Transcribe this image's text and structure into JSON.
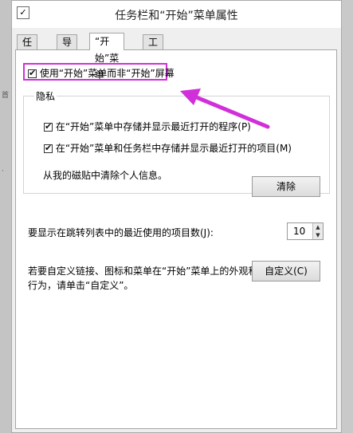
{
  "window": {
    "title": "任务栏和“开始”菜单属性",
    "title_icon": "checkbox-icon"
  },
  "tabs": [
    {
      "label": "任务栏",
      "active": false
    },
    {
      "label": "导航",
      "active": false
    },
    {
      "label": "“开始”菜单",
      "active": true
    },
    {
      "label": "工具栏",
      "active": false
    }
  ],
  "start_menu": {
    "use_start_screen": {
      "label": "使用“开始”菜单而非“开始”屏幕",
      "checked": true
    },
    "privacy": {
      "label": "隐私",
      "store_programs": {
        "label": "在“开始”菜单中存储并显示最近打开的程序(P)",
        "checked": true
      },
      "store_items": {
        "label": "在“开始”菜单和任务栏中存储并显示最近打开的项目(M)",
        "checked": true
      },
      "clear_text": "从我的磁贴中清除个人信息。",
      "clear_button": "清除"
    },
    "jump_list": {
      "label": "要显示在跳转列表中的最近使用的项目数(J):",
      "value": "10"
    },
    "customize": {
      "text_line1": "若要自定义链接、图标和菜单在“开始”菜单上的外观和",
      "text_line2": "行为，请单击“自定义”。",
      "button": "自定义(C)"
    }
  },
  "annotation": {
    "color": "#d12fd9"
  }
}
